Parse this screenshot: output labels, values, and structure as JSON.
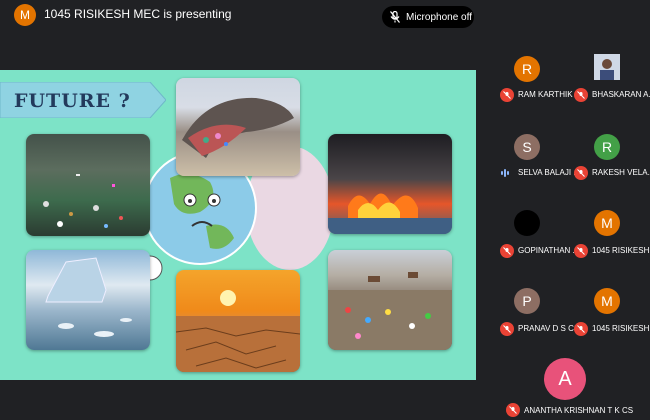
{
  "header": {
    "presenter_initial": "M",
    "presenter_text": "1045 RISIKESH MEC is presenting",
    "mic_status": "Microphone off"
  },
  "slide": {
    "title": "FUTURE ?",
    "photos": [
      "ocean-pollution-photo",
      "dead-whale-plastic-photo",
      "burning-trash-photo",
      "melting-glacier-photo",
      "drought-sunset-photo",
      "landfill-cows-photo"
    ]
  },
  "participants": [
    {
      "initial": "R",
      "name": "RAM KARTHIK ...",
      "color": "#e37400",
      "muted": true
    },
    {
      "initial": "",
      "name": "BHASKARAN A...",
      "color": "#5f7aa8",
      "muted": true,
      "photo": true
    },
    {
      "initial": "S",
      "name": "SELVA BALAJI ...",
      "color": "#8d6e63",
      "muted": false
    },
    {
      "initial": "R",
      "name": "RAKESH VELA...",
      "color": "#43a047",
      "muted": true
    },
    {
      "initial": "",
      "name": "GOPINATHAN ...",
      "color": "#000000",
      "muted": true
    },
    {
      "initial": "M",
      "name": "1045 RISIKESH...",
      "color": "#e37400",
      "muted": true
    },
    {
      "initial": "P",
      "name": "PRANAV D S CS",
      "color": "#8d6e63",
      "muted": true
    },
    {
      "initial": "M",
      "name": "1045 RISIKESH...",
      "color": "#e37400",
      "muted": true
    }
  ],
  "bottom_participant": {
    "initial": "A",
    "name": "ANANTHA KRISHNAN T K CS",
    "color": "#e8527a",
    "muted": true
  },
  "colors": {
    "accent_mute": "#ea4335",
    "slide_bg": "#7de3c7",
    "title_color": "#233a5c"
  }
}
